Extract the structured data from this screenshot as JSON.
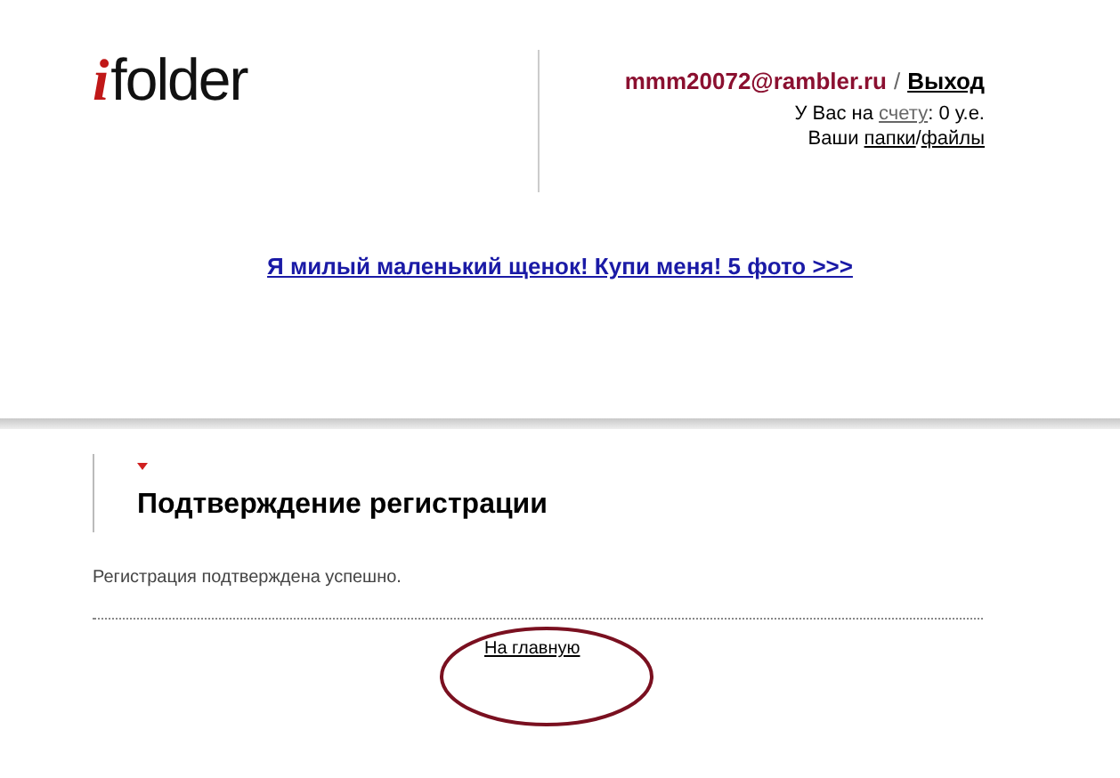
{
  "logo": {
    "mark": "i",
    "text": "folder"
  },
  "user": {
    "email": "mmm20072@rambler.ru",
    "separator": "/",
    "logout": "Выход"
  },
  "account": {
    "prefix": "У Вас на",
    "link": "счету",
    "suffix": ": 0 у.е."
  },
  "files": {
    "prefix": "Ваши",
    "folders_link": "папки",
    "separator": "/",
    "files_link": "файлы"
  },
  "promo_link": "Я милый маленький щенок! Купи меня! 5 фото >>>",
  "section": {
    "title": "Подтверждение регистрации",
    "message": "Регистрация подтверждена успешно.",
    "home_link": "На главную"
  }
}
